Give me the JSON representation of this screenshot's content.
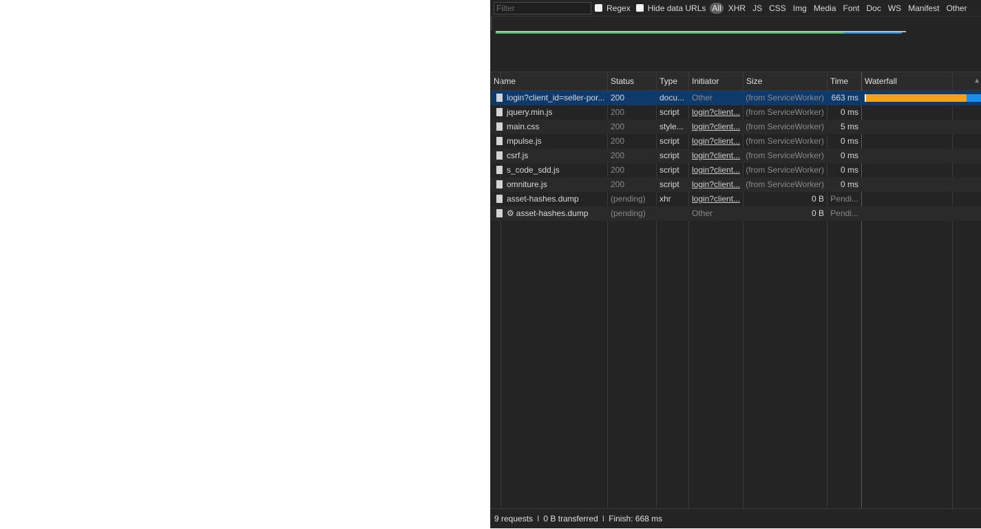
{
  "filter_bar": {
    "filter_placeholder": "Filter",
    "regex_label": "Regex",
    "hide_data_urls_label": "Hide data URLs",
    "resource_types": [
      "All",
      "XHR",
      "JS",
      "CSS",
      "Img",
      "Media",
      "Font",
      "Doc",
      "WS",
      "Manifest",
      "Other"
    ],
    "active_type": "All"
  },
  "columns": {
    "name": "Name",
    "status": "Status",
    "type": "Type",
    "initiator": "Initiator",
    "size": "Size",
    "time": "Time",
    "waterfall": "Waterfall"
  },
  "requests": [
    {
      "icon": "file-icon",
      "name": "login?client_id=seller-por...",
      "status": "200",
      "type": "docu...",
      "initiator": "Other",
      "size": "(from ServiceWorker)",
      "time": "663 ms",
      "selected": true
    },
    {
      "icon": "file-icon",
      "name": "jquery.min.js",
      "status": "200",
      "type": "script",
      "initiator": "login?client...",
      "size": "(from ServiceWorker)",
      "time": "0 ms"
    },
    {
      "icon": "file-icon",
      "name": "main.css",
      "status": "200",
      "type": "style...",
      "initiator": "login?client...",
      "size": "(from ServiceWorker)",
      "time": "5 ms"
    },
    {
      "icon": "file-icon",
      "name": "mpulse.js",
      "status": "200",
      "type": "script",
      "initiator": "login?client...",
      "size": "(from ServiceWorker)",
      "time": "0 ms"
    },
    {
      "icon": "file-icon",
      "name": "csrf.js",
      "status": "200",
      "type": "script",
      "initiator": "login?client...",
      "size": "(from ServiceWorker)",
      "time": "0 ms"
    },
    {
      "icon": "file-icon",
      "name": "s_code_sdd.js",
      "status": "200",
      "type": "script",
      "initiator": "login?client...",
      "size": "(from ServiceWorker)",
      "time": "0 ms"
    },
    {
      "icon": "file-icon",
      "name": "omniture.js",
      "status": "200",
      "type": "script",
      "initiator": "login?client...",
      "size": "(from ServiceWorker)",
      "time": "0 ms"
    },
    {
      "icon": "file-icon",
      "name": "asset-hashes.dump",
      "status": "(pending)",
      "type": "xhr",
      "initiator": "login?client...",
      "size": "0 B",
      "time": "Pendi..."
    },
    {
      "icon": "gear-icon",
      "name": "asset-hashes.dump",
      "status": "(pending)",
      "type": "",
      "initiator": "Other",
      "size": "0 B",
      "time": "Pendi..."
    }
  ],
  "footer": {
    "requests": "9 requests",
    "transferred": "0 B transferred",
    "finish": "Finish: 668 ms",
    "separator": "I"
  },
  "colors": {
    "selected_row": "#0e3a6b",
    "waterfall_waiting": "#f4a11a",
    "waterfall_download": "#1a8ee8",
    "overview_green": "#3fbf5a",
    "overview_blue": "#1a8ee8"
  }
}
